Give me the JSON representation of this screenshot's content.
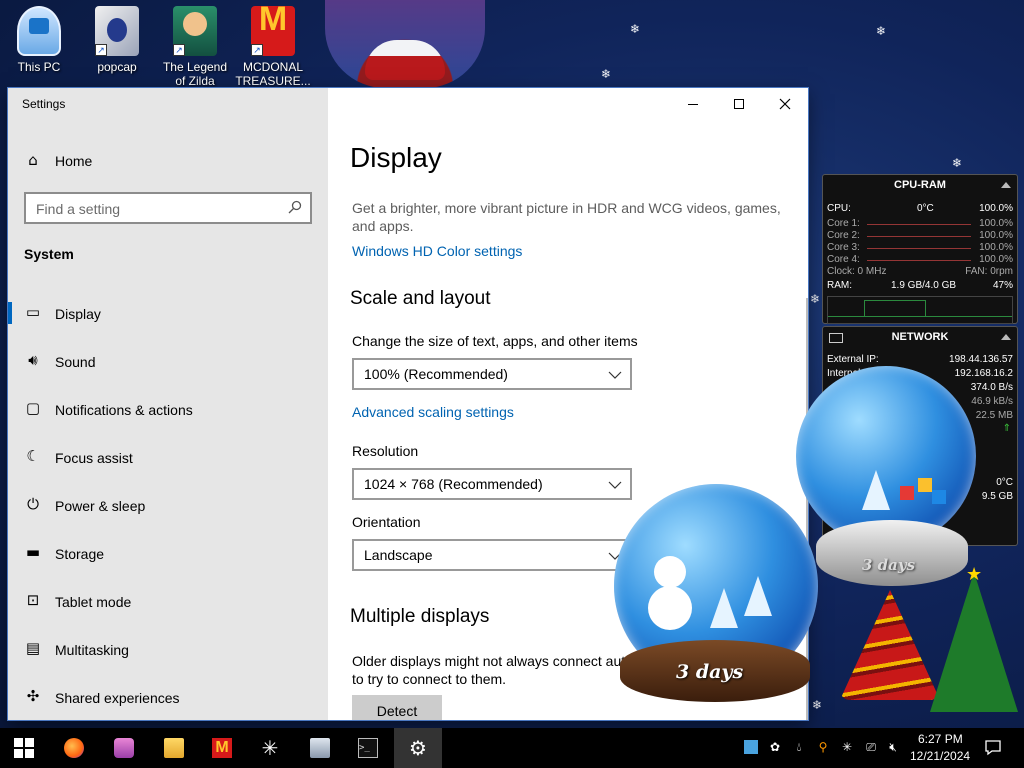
{
  "desktop": {
    "icons": [
      {
        "label": "This PC"
      },
      {
        "label": "popcap"
      },
      {
        "label": "The Legend\nof Zilda"
      },
      {
        "label": "MCDONAL\nTREASURE..."
      }
    ]
  },
  "window": {
    "title": "Settings",
    "minimize_icon": "minimize-icon",
    "maximize_icon": "maximize-icon",
    "close_icon": "close-icon"
  },
  "sidebar": {
    "home_label": "Home",
    "search_placeholder": "Find a setting",
    "section_heading": "System",
    "items": [
      {
        "label": "Display",
        "icon": "monitor-icon",
        "glyph": "▭",
        "active": true
      },
      {
        "label": "Sound",
        "icon": "speaker-icon",
        "glyph": "🔊︎"
      },
      {
        "label": "Notifications & actions",
        "icon": "notification-icon",
        "glyph": "▢"
      },
      {
        "label": "Focus assist",
        "icon": "moon-icon",
        "glyph": "☾"
      },
      {
        "label": "Power & sleep",
        "icon": "power-icon",
        "glyph": "⏻"
      },
      {
        "label": "Storage",
        "icon": "drive-icon",
        "glyph": "▬"
      },
      {
        "label": "Tablet mode",
        "icon": "tablet-icon",
        "glyph": "⊡"
      },
      {
        "label": "Multitasking",
        "icon": "multitasking-icon",
        "glyph": "▤"
      },
      {
        "label": "Shared experiences",
        "icon": "share-icon",
        "glyph": "✣"
      }
    ]
  },
  "content": {
    "title": "Display",
    "hdr_description": "Get a brighter, more vibrant picture in HDR and WCG videos, games, and apps.",
    "hdr_link": "Windows HD Color settings",
    "scale_heading": "Scale and layout",
    "scale_label": "Change the size of text, apps, and other items",
    "scale_value": "100% (Recommended)",
    "advanced_link": "Advanced scaling settings",
    "resolution_label": "Resolution",
    "resolution_value": "1024 × 768 (Recommended)",
    "orientation_label": "Orientation",
    "orientation_value": "Landscape",
    "multi_heading": "Multiple displays",
    "multi_description": "Older displays might not always connect aut... to try to connect to them.",
    "detect_label": "Detect"
  },
  "cpu_gadget": {
    "title": "CPU-RAM",
    "cpu_label": "CPU:",
    "cpu_temp": "0°C",
    "cpu_percent": "100.0%",
    "cores": [
      {
        "label": "Core 1:",
        "value": "100.0%"
      },
      {
        "label": "Core 2:",
        "value": "100.0%"
      },
      {
        "label": "Core 3:",
        "value": "100.0%"
      },
      {
        "label": "Core 4:",
        "value": "100.0%"
      }
    ],
    "clock_label": "Clock: 0 MHz",
    "fan_label": "FAN: 0rpm",
    "ram_label": "RAM:",
    "ram_value": "1.9 GB/4.0 GB",
    "ram_percent": "47%"
  },
  "net_gadget": {
    "title": "NETWORK",
    "external_ip_label": "External IP:",
    "external_ip": "198.44.136.57",
    "internal_ip_label": "Internal",
    "internal_ip": "192.168.16.2",
    "speed": "374.0 B/s",
    "sub_speed": "46.9 kB/s",
    "sub_total": "22.5 MB",
    "extra_temp": "0°C",
    "extra_size": "9.5 GB"
  },
  "globes": {
    "left_days": "3 days",
    "right_days": "3 days"
  },
  "taskbar": {
    "apps": [
      {
        "name": "start-button",
        "icon": "windows-logo-icon"
      },
      {
        "name": "firefox-button",
        "icon": "firefox-icon"
      },
      {
        "name": "game-app-button",
        "icon": "game-icon"
      },
      {
        "name": "file-explorer-button",
        "icon": "folder-icon"
      },
      {
        "name": "mcdonalds-app-button",
        "icon": "mcdonalds-icon"
      },
      {
        "name": "snowflake-app-button",
        "icon": "snowflake-icon"
      },
      {
        "name": "network-app-button",
        "icon": "computer-icon"
      },
      {
        "name": "terminal-button",
        "icon": "terminal-icon"
      },
      {
        "name": "settings-taskbar-button",
        "icon": "gear-icon",
        "active": true
      }
    ],
    "time": "6:27 PM",
    "date": "12/21/2024"
  },
  "colors": {
    "accent": "#0067c0",
    "link": "#0063b1",
    "sidebar_bg": "#e6e6e6",
    "taskbar_bg": "#000000"
  }
}
